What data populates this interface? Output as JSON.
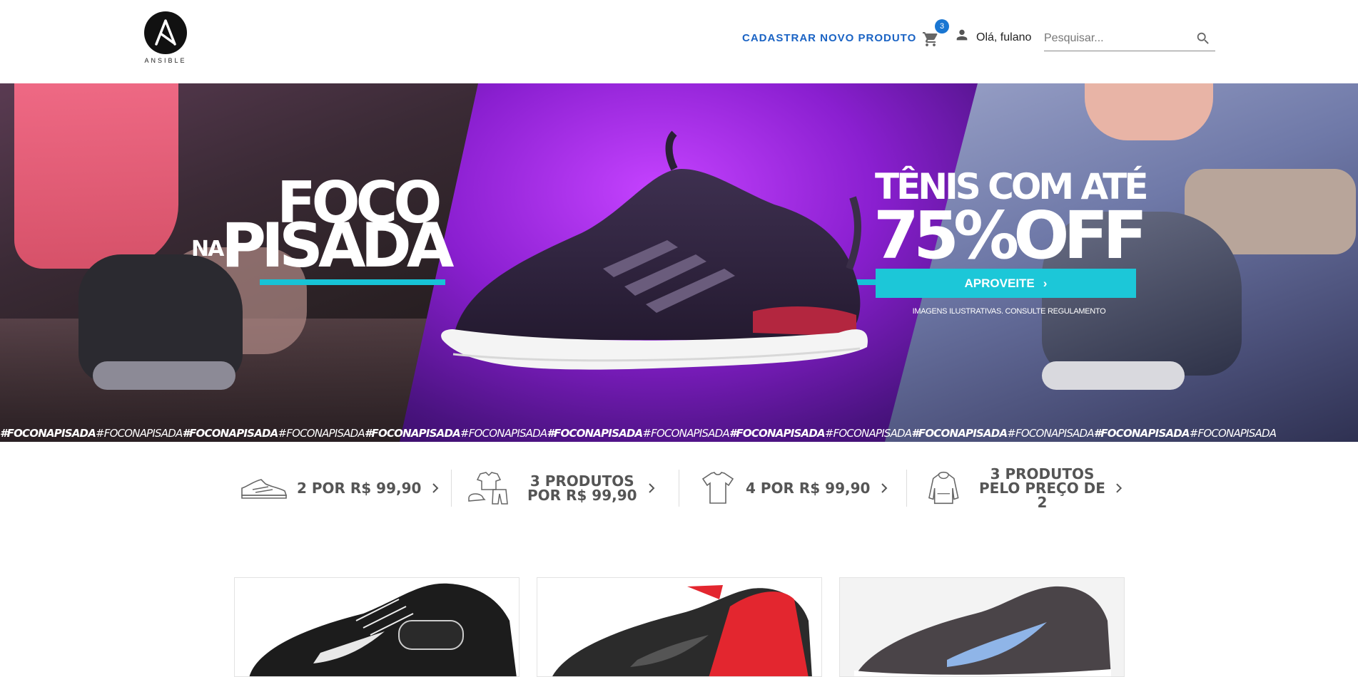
{
  "header": {
    "logo_text": "ANSIBLE",
    "nav_link": "CADASTRAR NOVO PRODUTO",
    "cart_count": "3",
    "greeting": "Olá, fulano",
    "search_placeholder": "Pesquisar..."
  },
  "banner": {
    "foco": "FOCO",
    "na": "NA",
    "pisada": "PISADA",
    "tenis": "TÊNIS COM ATÉ",
    "off": "75%OFF",
    "cta": "APROVEITE",
    "disclaimer": "IMAGENS ILUSTRATIVAS. CONSULTE REGULAMENTO",
    "hashtags": [
      "#FOCONAPISADA",
      "#FOCONAPISADA",
      "#FOCONAPISADA",
      "#FOCONAPISADA",
      "#FOCONAPISADA",
      "#FOCONAPISADA",
      "#FOCONAPISADA",
      "#FOCONAPISADA",
      "#FOCONAPISADA",
      "#FOCONAPISADA",
      "#FOCONAPISADA",
      "#FOCONAPISADA",
      "#FOCONAPISADA",
      "#FOCONAPISADA"
    ]
  },
  "promos": [
    {
      "line1": "2 POR R$ 99,90",
      "line2": "",
      "icon": "sneaker-icon"
    },
    {
      "line1": "3 PRODUTOS",
      "line2": "POR R$ 99,90",
      "icon": "clothing-set-icon"
    },
    {
      "line1": "4 POR R$ 99,90",
      "line2": "",
      "icon": "tshirt-icon"
    },
    {
      "line1": "3 PRODUTOS",
      "line2": "PELO PREÇO DE 2",
      "icon": "hoodie-icon"
    }
  ],
  "colors": {
    "accent_blue": "#1a63c4",
    "badge_blue": "#1976d2",
    "cta_cyan": "#1cc7d8"
  }
}
